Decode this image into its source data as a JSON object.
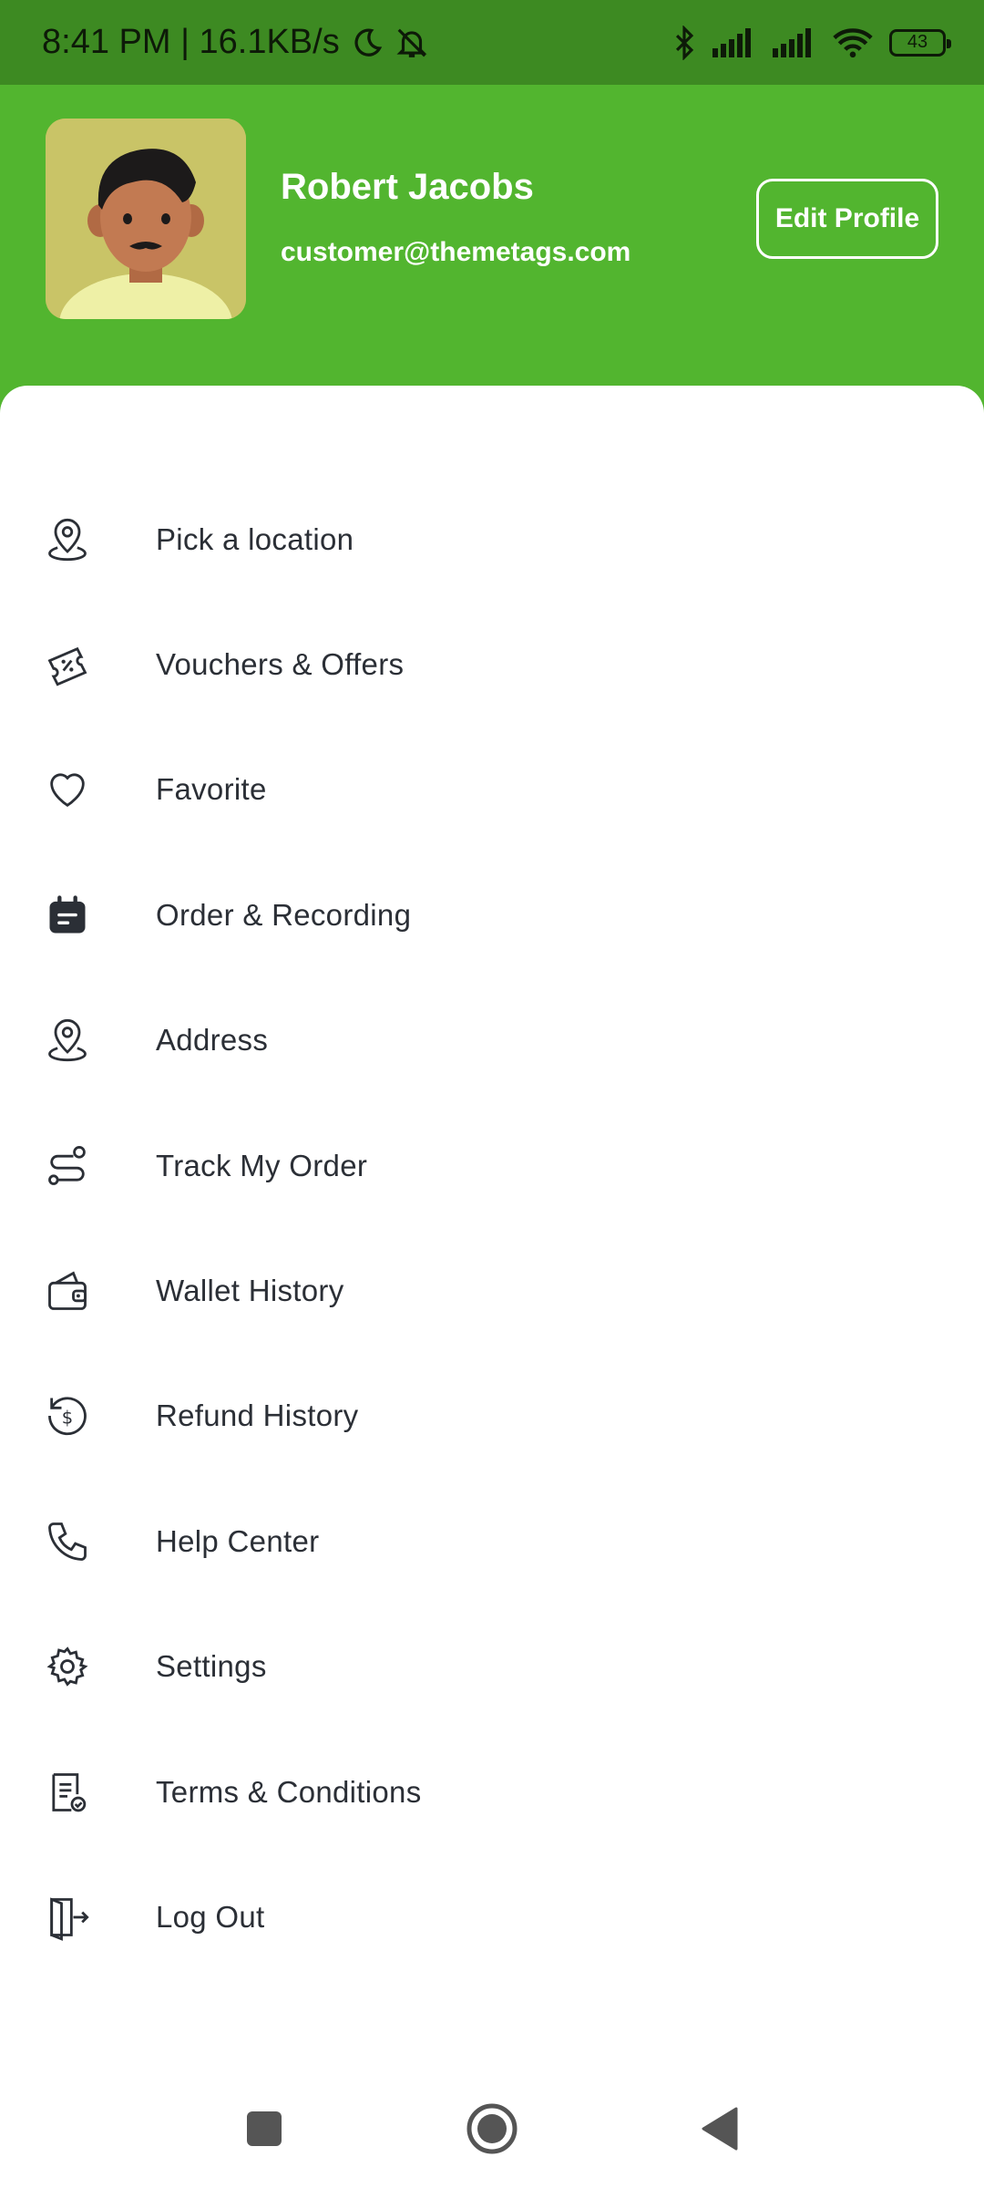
{
  "status_bar": {
    "time_speed": "8:41 PM | 16.1KB/s",
    "battery": "43",
    "icons": [
      "moon-icon",
      "muted-bell-icon",
      "bluetooth-icon",
      "signal-icon",
      "signal-icon",
      "wifi-icon",
      "battery-icon"
    ]
  },
  "profile": {
    "name": "Robert Jacobs",
    "email": "customer@themetags.com",
    "edit_label": "Edit Profile"
  },
  "colors": {
    "header": "#52b52f",
    "status_bar": "#3d8a22",
    "text": "#2b2f36"
  },
  "menu": {
    "items": [
      {
        "label": "Pick a location",
        "icon": "location-pin-icon"
      },
      {
        "label": "Vouchers & Offers",
        "icon": "voucher-icon"
      },
      {
        "label": "Favorite",
        "icon": "heart-icon"
      },
      {
        "label": "Order & Recording",
        "icon": "calendar-icon"
      },
      {
        "label": "Address",
        "icon": "location-pin-icon"
      },
      {
        "label": "Track My Order",
        "icon": "route-icon"
      },
      {
        "label": "Wallet History",
        "icon": "wallet-icon"
      },
      {
        "label": "Refund History",
        "icon": "refund-icon"
      },
      {
        "label": "Help Center",
        "icon": "phone-icon"
      },
      {
        "label": "Settings",
        "icon": "gear-icon"
      },
      {
        "label": "Terms & Conditions",
        "icon": "document-icon"
      },
      {
        "label": "Log Out",
        "icon": "logout-icon"
      }
    ]
  },
  "nav": {
    "icons": [
      "square-icon",
      "home-circle-icon",
      "back-triangle-icon"
    ]
  }
}
